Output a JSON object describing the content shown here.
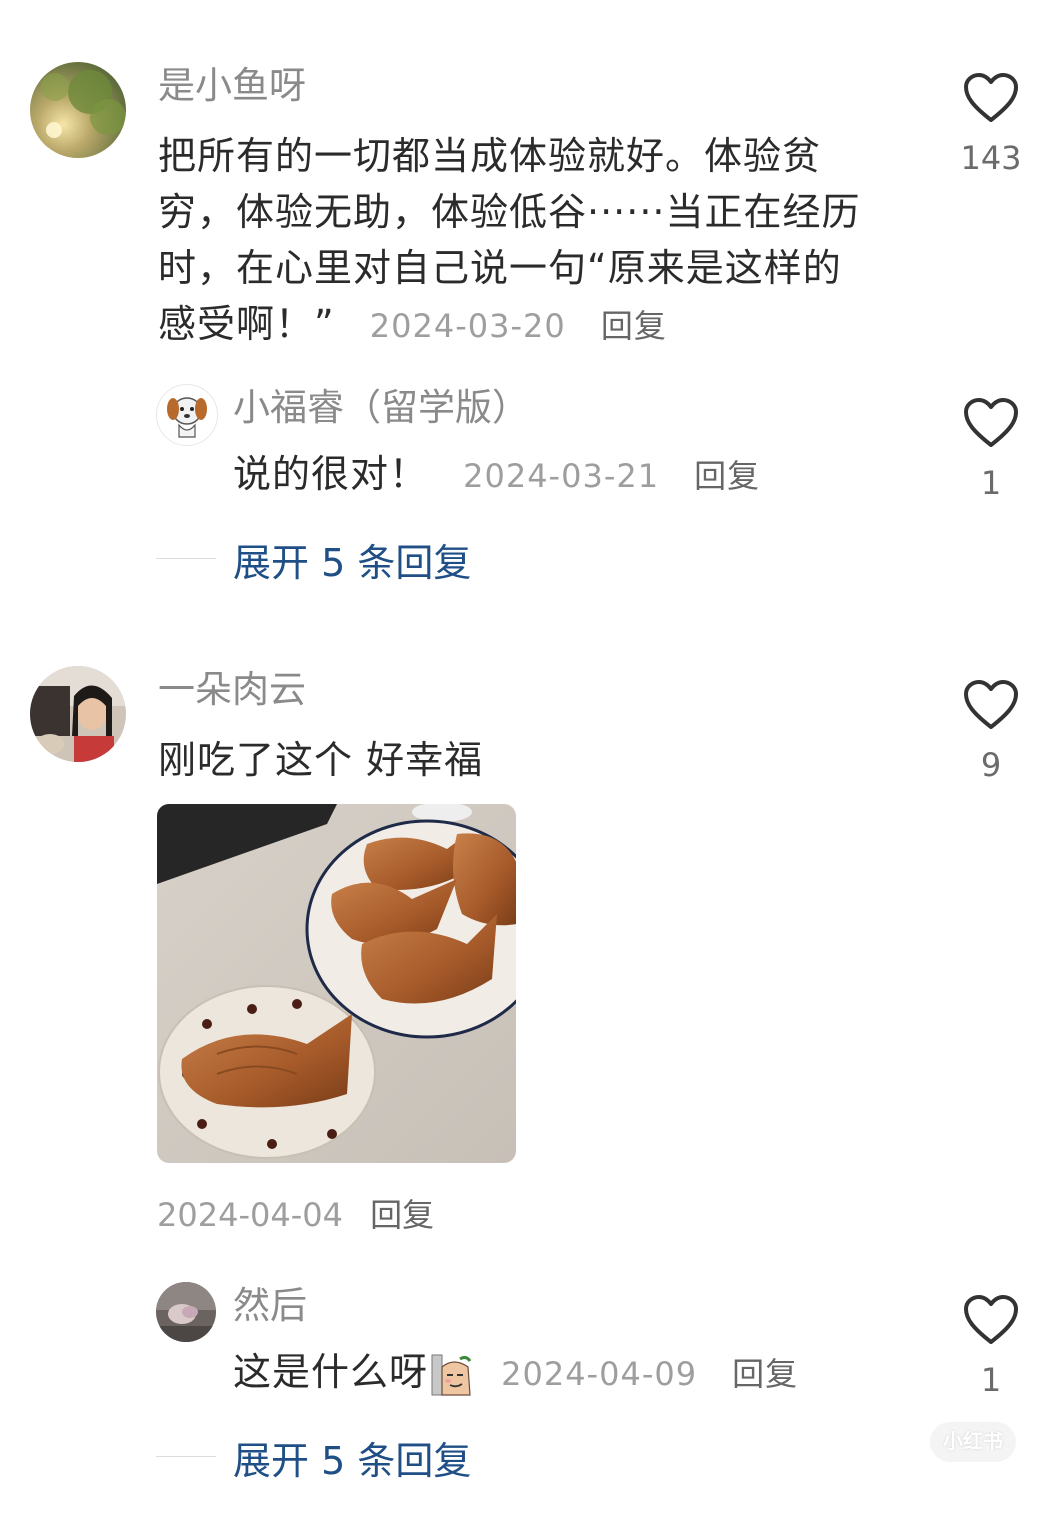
{
  "comments": [
    {
      "username": "是小鱼呀",
      "text": "把所有的一切都当成体验就好。体验贫穷，体验无助，体验低谷······当正在经历时，在心里对自己说一句“原来是这样的感受啊！”",
      "date": "2024-03-20",
      "reply_label": "回复",
      "likes": "143",
      "replies": [
        {
          "username": "小福睿（留学版）",
          "text": "说的很对！",
          "date": "2024-03-21",
          "reply_label": "回复",
          "likes": "1"
        }
      ],
      "expand_label": "展开 5 条回复"
    },
    {
      "username": "一朵肉云",
      "text": "刚吃了这个 好幸福",
      "date": "2024-04-04",
      "reply_label": "回复",
      "likes": "9",
      "replies": [
        {
          "username": "然后",
          "text": "这是什么呀",
          "date": "2024-04-09",
          "reply_label": "回复",
          "likes": "1"
        }
      ],
      "expand_label": "展开 5 条回复"
    }
  ],
  "watermark": "小红书",
  "icons": {
    "like": "heart-outline-icon"
  },
  "colors": {
    "link": "#1f4f86",
    "meta": "#9e9e9e",
    "text": "#2b2b2b"
  }
}
